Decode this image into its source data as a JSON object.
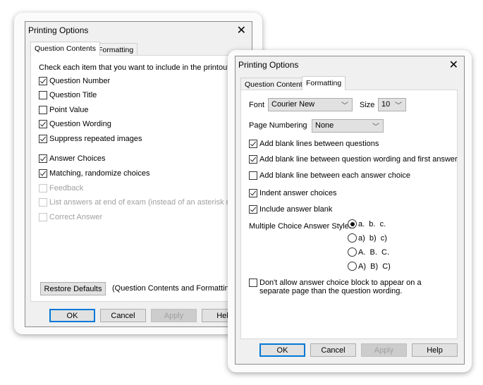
{
  "left_dialog": {
    "title": "Printing Options",
    "tabs": [
      {
        "label": "Question Contents",
        "active": true
      },
      {
        "label": "Formatting",
        "active": false
      }
    ],
    "instruction": "Check each item that you want to include in the printout.",
    "items": [
      {
        "label": "Question Number",
        "checked": true,
        "enabled": true
      },
      {
        "label": "Question Title",
        "checked": false,
        "enabled": true
      },
      {
        "label": "Point Value",
        "checked": false,
        "enabled": true
      },
      {
        "label": "Question Wording",
        "checked": true,
        "enabled": true
      },
      {
        "label": "Suppress repeated images",
        "checked": true,
        "enabled": true
      },
      {
        "label": "Answer Choices",
        "checked": true,
        "enabled": true
      },
      {
        "label": "Matching, randomize choices",
        "checked": true,
        "enabled": true
      },
      {
        "label": "Feedback",
        "checked": false,
        "enabled": false
      },
      {
        "label": "List answers at end of exam (instead of an asterisk mark)",
        "checked": false,
        "enabled": false
      },
      {
        "label": "Correct Answer",
        "checked": false,
        "enabled": false
      }
    ],
    "restore_defaults": "Restore Defaults",
    "restore_note": "(Question Contents and Formatting)",
    "buttons": {
      "ok": "OK",
      "cancel": "Cancel",
      "apply": "Apply",
      "help": "Help"
    }
  },
  "right_dialog": {
    "title": "Printing Options",
    "tabs": [
      {
        "label": "Question Contents",
        "active": false
      },
      {
        "label": "Formatting",
        "active": true
      }
    ],
    "font_label": "Font",
    "font_value": "Courier New",
    "size_label": "Size",
    "size_value": "10",
    "page_numbering_label": "Page Numbering",
    "page_numbering_value": "None",
    "options": [
      {
        "label": "Add blank lines between questions",
        "checked": true
      },
      {
        "label": "Add blank line between question wording and first answer",
        "checked": true
      },
      {
        "label": "Add blank line between each answer choice",
        "checked": false
      },
      {
        "label": "Indent answer choices",
        "checked": true
      },
      {
        "label": "Include answer blank",
        "checked": true
      }
    ],
    "mc_label": "Multiple Choice Answer Styles:",
    "mc_styles": [
      {
        "label": "a.  b.  c.",
        "selected": true
      },
      {
        "label": "a)  b)  c)",
        "selected": false
      },
      {
        "label": "A.  B.  C.",
        "selected": false
      },
      {
        "label": "A)  B)  C)",
        "selected": false
      }
    ],
    "block_option": {
      "line1": "Don't allow answer choice block to appear on a",
      "line2": "separate page than the question wording.",
      "checked": false
    },
    "buttons": {
      "ok": "OK",
      "cancel": "Cancel",
      "apply": "Apply",
      "help": "Help"
    }
  }
}
